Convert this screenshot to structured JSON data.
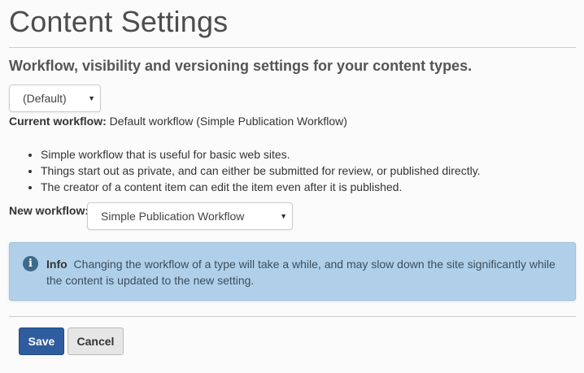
{
  "page": {
    "title": "Content Settings",
    "subtitle": "Workflow, visibility and versioning settings for your content types."
  },
  "type_select": {
    "value": "(Default)"
  },
  "current_workflow": {
    "label": "Current workflow:",
    "value": "Default workflow (Simple Publication Workflow)"
  },
  "bullets": [
    "Simple workflow that is useful for basic web sites.",
    "Things start out as private, and can either be submitted for review, or published directly.",
    "The creator of a content item can edit the item even after it is published."
  ],
  "new_workflow": {
    "label": "New workflow:",
    "value": "Simple Publication Workflow"
  },
  "info": {
    "icon": "info-icon",
    "title": "Info",
    "text": "Changing the workflow of a type will take a while, and may slow down the site significantly while the content is updated to the new setting."
  },
  "buttons": {
    "save": "Save",
    "cancel": "Cancel"
  },
  "colors": {
    "primary": "#2e5c9e",
    "info_bg": "#b0d0ea"
  }
}
